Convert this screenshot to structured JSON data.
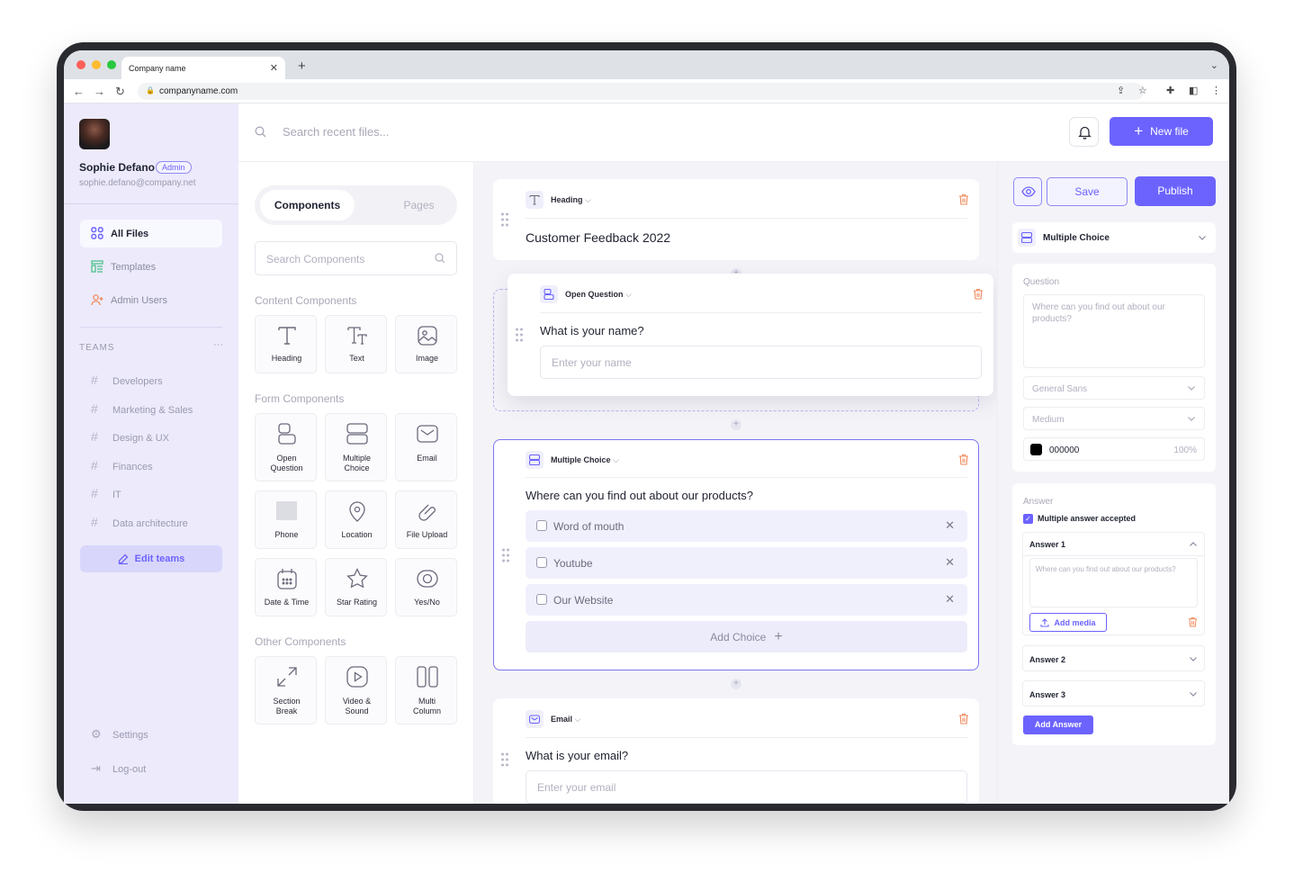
{
  "browser": {
    "tab_title": "Company name",
    "url": "companyname.com"
  },
  "user": {
    "name": "Sophie Defano",
    "role": "Admin",
    "email": "sophie.defano@company.net"
  },
  "sidebar": {
    "nav": [
      {
        "label": "All Files",
        "icon": "grid-icon",
        "active": true
      },
      {
        "label": "Templates",
        "icon": "templates-icon",
        "active": false
      },
      {
        "label": "Admin Users",
        "icon": "user-plus-icon",
        "active": false
      }
    ],
    "teams_heading": "TEAMS",
    "teams_more": "···",
    "teams": [
      "Developers",
      "Marketing & Sales",
      "Design & UX",
      "Finances",
      "IT",
      "Data architecture"
    ],
    "edit_teams": "Edit teams",
    "settings": "Settings",
    "logout": "Log-out"
  },
  "topbar": {
    "search_placeholder": "Search recent files...",
    "new_file": "New file"
  },
  "components_panel": {
    "tabs": [
      "Components",
      "Pages"
    ],
    "search_placeholder": "Search Components",
    "content_heading": "Content Components",
    "content": [
      "Heading",
      "Text",
      "Image"
    ],
    "form_heading": "Form Components",
    "form": [
      [
        "Open",
        "Question"
      ],
      [
        "Multiple",
        "Choice"
      ],
      [
        "Email"
      ],
      [
        "Phone"
      ],
      [
        "Location"
      ],
      [
        "File Upload"
      ],
      [
        "Date & Time"
      ],
      [
        "Star Rating"
      ],
      [
        "Yes/No"
      ]
    ],
    "other_heading": "Other Components",
    "other": [
      [
        "Section",
        "Break"
      ],
      [
        "Video &",
        "Sound"
      ],
      [
        "Multi",
        "Column"
      ]
    ]
  },
  "canvas": {
    "heading_card": {
      "type": "Heading",
      "text": "Customer Feedback 2022"
    },
    "open_question_card": {
      "type": "Open Question",
      "question": "What is your name?",
      "placeholder": "Enter your name"
    },
    "multiple_choice_card": {
      "type": "Multiple Choice",
      "question": "Where can you find out about our products?",
      "choices": [
        "Word of mouth",
        "Youtube",
        "Our Website"
      ],
      "add_choice": "Add Choice"
    },
    "email_card": {
      "type": "Email",
      "question": "What is your email?",
      "placeholder": "Enter your email"
    }
  },
  "properties": {
    "save": "Save",
    "publish": "Publish",
    "component_type": "Multiple Choice",
    "question_label": "Question",
    "question_value": "Where can you find out about our products?",
    "font": "General Sans",
    "weight": "Medium",
    "color_hex": "000000",
    "opacity": "100%",
    "answer_label": "Answer",
    "multiple_accepted": "Multiple answer accepted",
    "answers": [
      "Answer 1",
      "Answer 2",
      "Answer 3"
    ],
    "answer1_text": "Where can you find out about our products?",
    "add_media": "Add media",
    "add_answer": "Add Answer"
  },
  "colors": {
    "accent": "#6c63ff",
    "sidebar_bg": "#eceafb",
    "danger": "#f08a5d"
  }
}
